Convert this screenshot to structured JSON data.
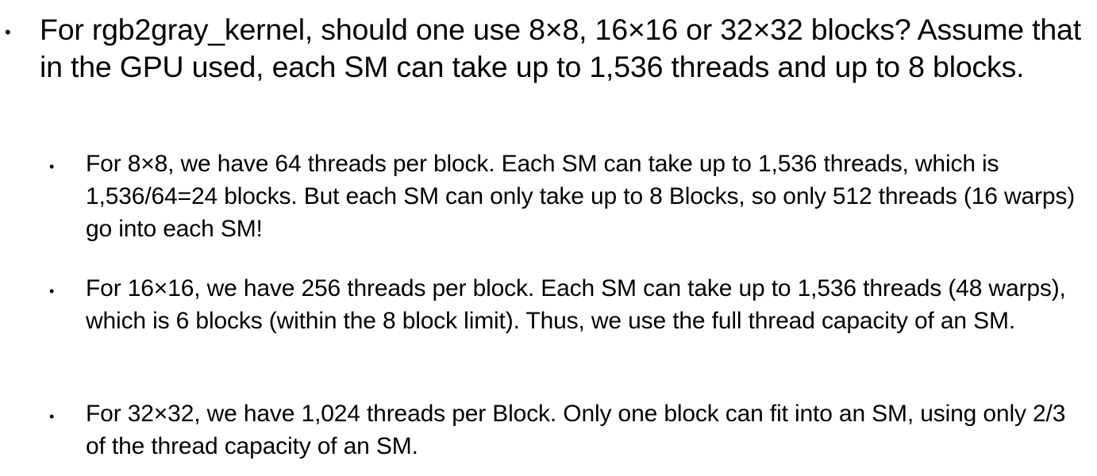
{
  "bullet_char": "•",
  "main": {
    "text": "For rgb2gray_kernel, should one use 8×8, 16×16 or 32×32 blocks? Assume that in the GPU used, each SM can take up to 1,536 threads and up to 8 blocks."
  },
  "sub_items": [
    {
      "text": "For 8×8, we have 64 threads per block. Each SM can take up to 1,536 threads, which is 1,536/64=24 blocks. But each SM can only take up to 8 Blocks, so only 512 threads (16 warps) go into each SM!"
    },
    {
      "text": "For 16×16, we have 256 threads per block. Each SM can take up to 1,536 threads (48 warps), which is 6 blocks (within the 8 block limit). Thus, we use the full thread capacity of an SM."
    },
    {
      "text": "For 32×32, we have 1,024 threads per Block. Only one block can fit into an SM, using only 2/3 of the thread capacity of an SM."
    }
  ]
}
